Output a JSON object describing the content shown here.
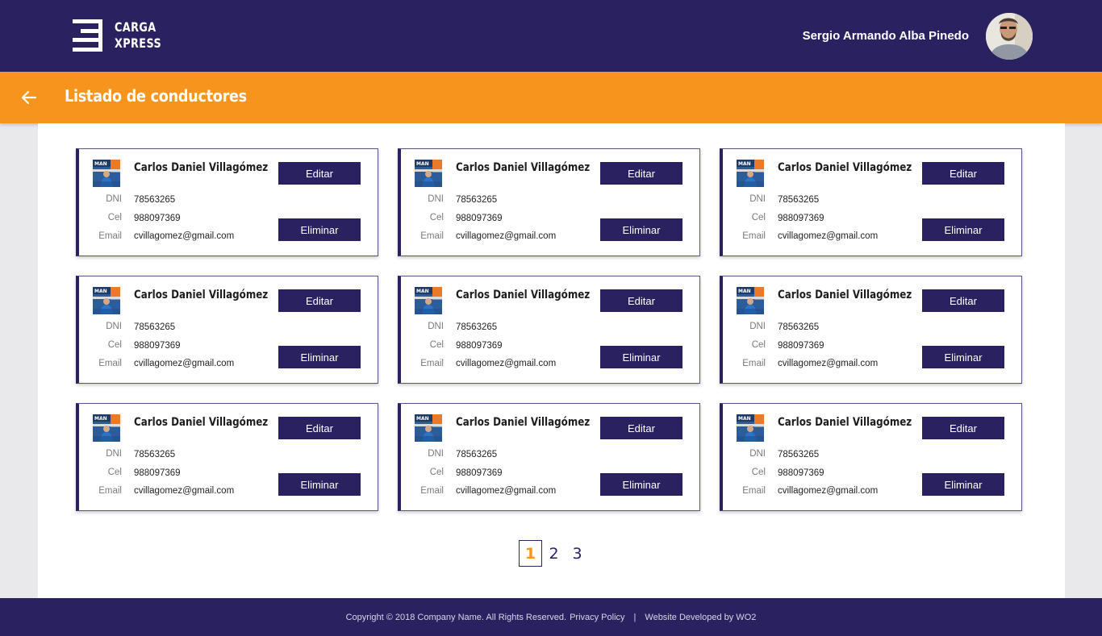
{
  "header": {
    "logo_line1": "CARGA",
    "logo_line2": "XPRESS",
    "user_name": "Sergio Armando Alba Pinedo"
  },
  "subheader": {
    "title": "Listado de conductores"
  },
  "labels": {
    "dni": "DNI",
    "cel": "Cel",
    "email": "Email",
    "edit": "Editar",
    "delete": "Eliminar"
  },
  "drivers": [
    {
      "name": "Carlos Daniel Villagómez",
      "dni": "78563265",
      "cel": "988097369",
      "email": "cvillagomez@gmail.com"
    },
    {
      "name": "Carlos Daniel Villagómez",
      "dni": "78563265",
      "cel": "988097369",
      "email": "cvillagomez@gmail.com"
    },
    {
      "name": "Carlos Daniel Villagómez",
      "dni": "78563265",
      "cel": "988097369",
      "email": "cvillagomez@gmail.com"
    },
    {
      "name": "Carlos Daniel Villagómez",
      "dni": "78563265",
      "cel": "988097369",
      "email": "cvillagomez@gmail.com"
    },
    {
      "name": "Carlos Daniel Villagómez",
      "dni": "78563265",
      "cel": "988097369",
      "email": "cvillagomez@gmail.com"
    },
    {
      "name": "Carlos Daniel Villagómez",
      "dni": "78563265",
      "cel": "988097369",
      "email": "cvillagomez@gmail.com"
    },
    {
      "name": "Carlos Daniel Villagómez",
      "dni": "78563265",
      "cel": "988097369",
      "email": "cvillagomez@gmail.com"
    },
    {
      "name": "Carlos Daniel Villagómez",
      "dni": "78563265",
      "cel": "988097369",
      "email": "cvillagomez@gmail.com"
    },
    {
      "name": "Carlos Daniel Villagómez",
      "dni": "78563265",
      "cel": "988097369",
      "email": "cvillagomez@gmail.com"
    }
  ],
  "pagination": {
    "pages": [
      "1",
      "2",
      "3"
    ],
    "active": "1"
  },
  "footer": {
    "copyright": "Copyright © 2018 Company Name. All Rights Reserved.",
    "privacy": "Privacy Policy",
    "separator": "|",
    "developed": "Website Developed by WO2"
  },
  "colors": {
    "primary": "#2a2160",
    "accent": "#f7941e",
    "background": "#e9e9ec"
  }
}
